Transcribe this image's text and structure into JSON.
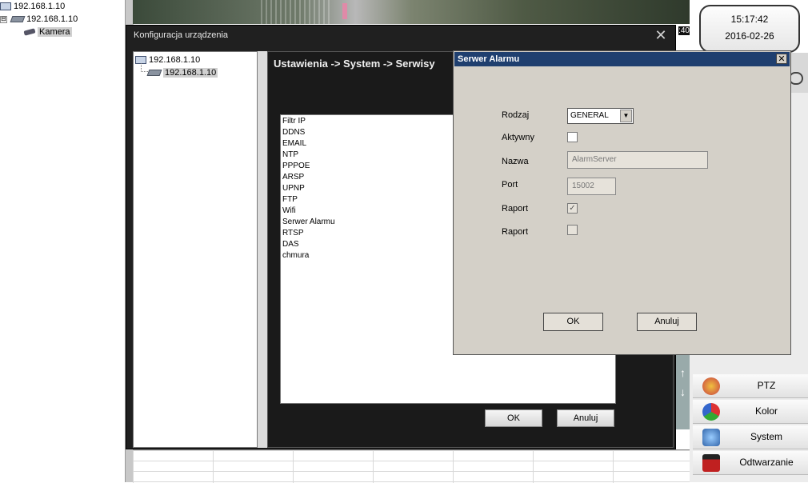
{
  "left_tree": {
    "items": [
      {
        "label": "192.168.1.10"
      },
      {
        "label": "192.168.1.10"
      },
      {
        "label": "Kamera"
      }
    ],
    "expander": "⊟"
  },
  "video": {
    "timestamp_fragment": ":40"
  },
  "clock": {
    "time": "15:17:42",
    "date": "2016-02-26"
  },
  "right_panel": {
    "buttons": [
      {
        "label": "PTZ",
        "color": "#c84040"
      },
      {
        "label": "Kolor",
        "color": "#3a8a3a"
      },
      {
        "label": "System",
        "color": "#3a6ab0"
      },
      {
        "label": "Odtwarzanie",
        "color": "#c02020"
      }
    ]
  },
  "config_dialog": {
    "title": "Konfiguracja urządzenia",
    "close_glyph": "✕",
    "tree": [
      {
        "label": "192.168.1.10"
      },
      {
        "label": "192.168.1.10"
      }
    ],
    "breadcrumb": "Ustawienia -> System -> Serwisy",
    "services": [
      "Filtr IP",
      "DDNS",
      "EMAIL",
      "NTP",
      "PPPOE",
      "ARSP",
      "UPNP",
      "FTP",
      "Wifi",
      "Serwer Alarmu",
      "RTSP",
      "DAS",
      "chmura"
    ],
    "ok_label": "OK",
    "cancel_label": "Anuluj"
  },
  "alarm_dialog": {
    "title": "Serwer Alarmu",
    "close_glyph": "✕",
    "fields": {
      "rodzaj_label": "Rodzaj",
      "rodzaj_value": "GENERAL",
      "aktywny_label": "Aktywny",
      "aktywny_checked": false,
      "nazwa_label": "Nazwa",
      "nazwa_value": "AlarmServer",
      "port_label": "Port",
      "port_value": "15002",
      "raport1_label": "Raport",
      "raport1_checked": true,
      "raport2_label": "Raport",
      "raport2_checked": false
    },
    "ok_label": "OK",
    "cancel_label": "Anuluj"
  },
  "colors": {
    "dialog_dark": "#202020",
    "titlebar": "#1f3f6f",
    "win_gray": "#d4d0c8"
  }
}
